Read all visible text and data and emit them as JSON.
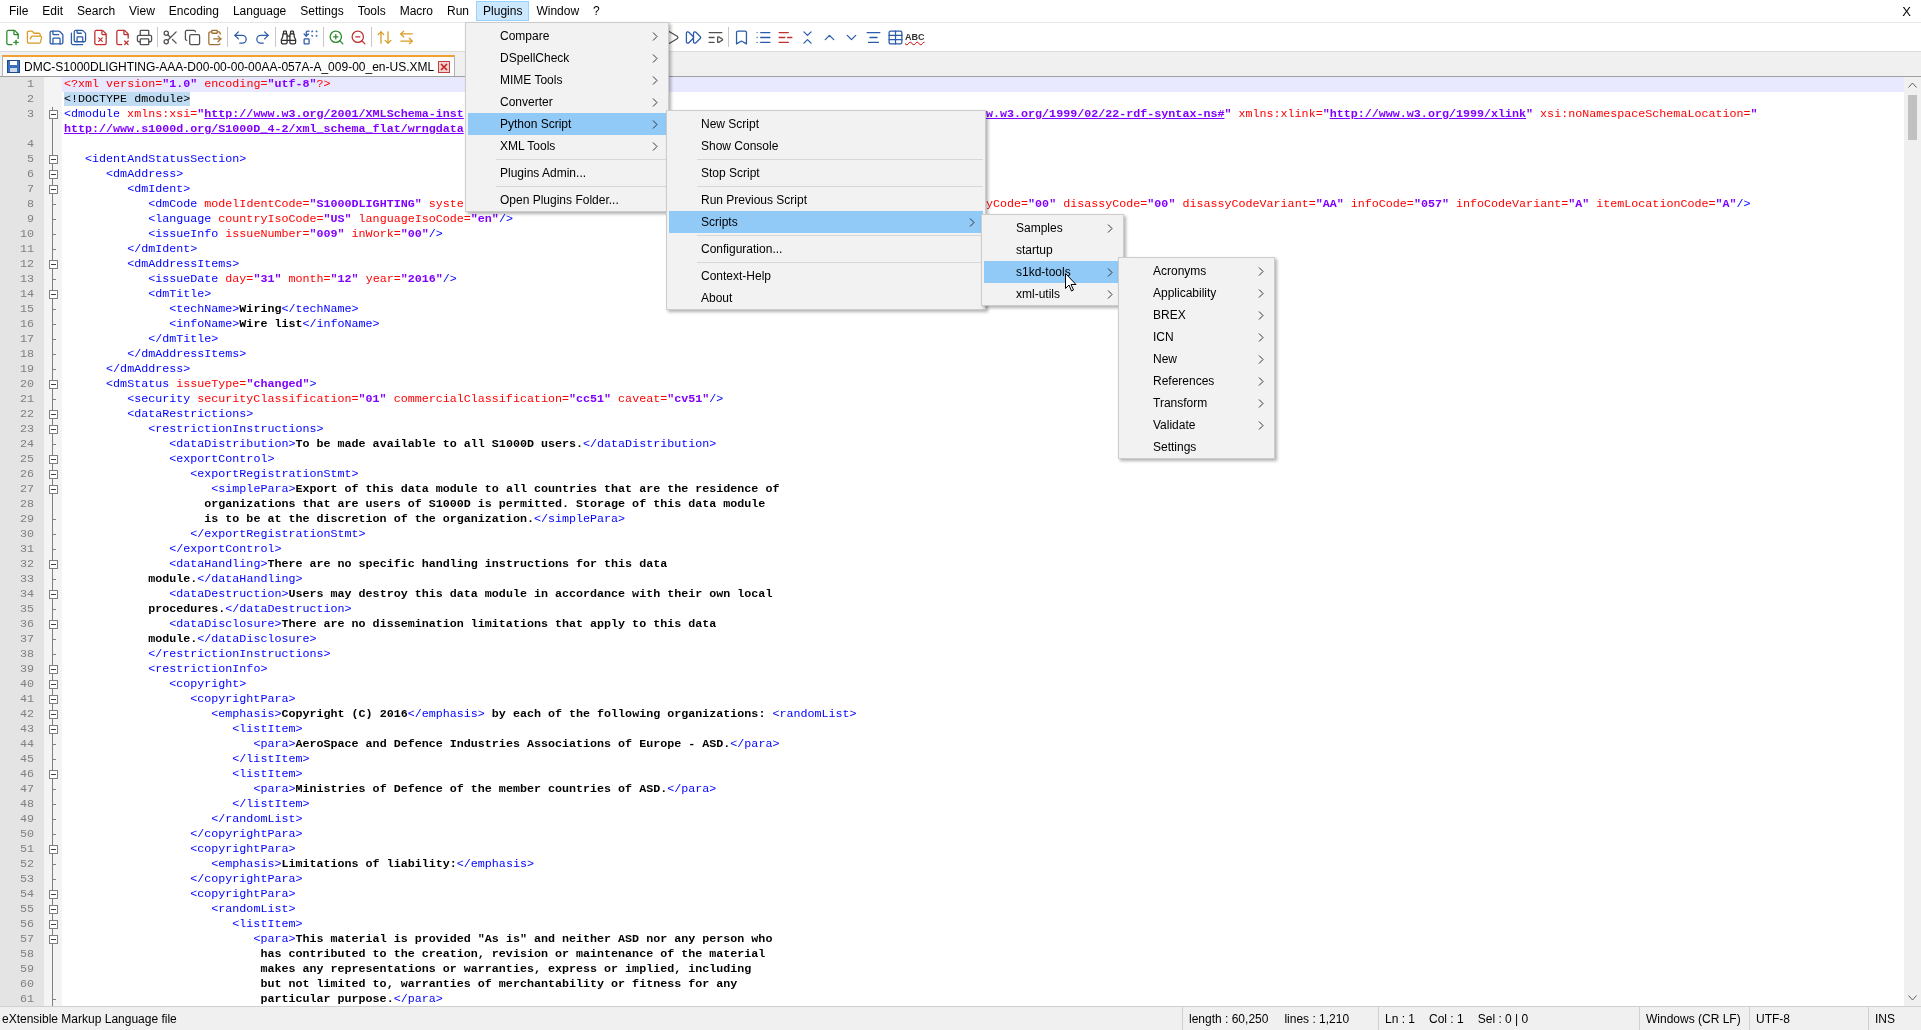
{
  "menu_bar": {
    "items": [
      {
        "label": "File",
        "selected": false
      },
      {
        "label": "Edit",
        "selected": false
      },
      {
        "label": "Search",
        "selected": false
      },
      {
        "label": "View",
        "selected": false
      },
      {
        "label": "Encoding",
        "selected": false
      },
      {
        "label": "Language",
        "selected": false
      },
      {
        "label": "Settings",
        "selected": false
      },
      {
        "label": "Tools",
        "selected": false
      },
      {
        "label": "Macro",
        "selected": false
      },
      {
        "label": "Run",
        "selected": false
      },
      {
        "label": "Plugins",
        "selected": true
      },
      {
        "label": "Window",
        "selected": false
      },
      {
        "label": "?",
        "selected": false
      }
    ],
    "close_label": "X"
  },
  "toolbar": {
    "spellcheck_label": "ABC"
  },
  "tabs": [
    {
      "label": "DMC-S1000DLIGHTING-AAA-D00-00-00-00AA-057A-A_009-00_en-US.XML",
      "selected": true
    }
  ],
  "lines": [
    {
      "n": "1",
      "kind": "none",
      "current": true,
      "tokens": [
        {
          "kind": "pi",
          "text": "<?xml"
        },
        {
          "kind": "attr",
          "text": " version="
        },
        {
          "kind": "val",
          "text": "\"1.0\""
        },
        {
          "kind": "attr",
          "text": " encoding="
        },
        {
          "kind": "val",
          "text": "\"utf-8\""
        },
        {
          "kind": "pi",
          "text": "?>"
        }
      ]
    },
    {
      "n": "2",
      "kind": "none",
      "current": false,
      "tokens": [
        {
          "kind": "match",
          "text": "<!DOCTYPE dmodule>"
        }
      ]
    },
    {
      "n": "3",
      "kind": "box",
      "current": false,
      "tokens": [
        {
          "kind": "tag",
          "text": "<dmodule"
        },
        {
          "kind": "attr",
          "text": " xmlns:xsi="
        },
        {
          "kind": "val",
          "text": "\""
        },
        {
          "kind": "link",
          "text": "http://www.w3.org/2001/XMLSchema-inst"
        }
      ],
      "resume": [
        {
          "kind": "link",
          "text": "w.w3.org/1999/02/22-rdf-syntax-ns#"
        },
        {
          "kind": "val",
          "text": "\""
        },
        {
          "kind": "attr",
          "text": " xmlns:xlink="
        },
        {
          "kind": "val",
          "text": "\""
        },
        {
          "kind": "link",
          "text": "http://www.w3.org/1999/xlink"
        },
        {
          "kind": "val",
          "text": "\""
        },
        {
          "kind": "attr",
          "text": " xsi:noNamespaceSchemaLocation="
        },
        {
          "kind": "val",
          "text": "\""
        }
      ],
      "wrap": [
        {
          "kind": "link",
          "text": "http://www.s1000d.org/S1000D_4-2/xml_schema_flat/wrngdata"
        }
      ]
    },
    {
      "n": "4",
      "kind": "line",
      "current": false
    },
    {
      "n": "5",
      "kind": "box",
      "current": false,
      "tokens": [
        {
          "kind": "tag",
          "text": "   <identAndStatusSection>"
        }
      ]
    },
    {
      "n": "6",
      "kind": "box",
      "current": false,
      "tokens": [
        {
          "kind": "tag",
          "text": "      <dmAddress>"
        }
      ]
    },
    {
      "n": "7",
      "kind": "box",
      "current": false,
      "tokens": [
        {
          "kind": "tag",
          "text": "         <dmIdent>"
        }
      ]
    },
    {
      "n": "8",
      "kind": "tick",
      "current": false,
      "tokens": [
        {
          "kind": "tag",
          "text": "            <dmCode"
        },
        {
          "kind": "attr",
          "text": " modelIdentCode="
        },
        {
          "kind": "val",
          "text": "\"S1000DLIGHTING\""
        },
        {
          "kind": "attr",
          "text": " syste"
        }
      ],
      "resume": [
        {
          "kind": "attr",
          "text": "yCode="
        },
        {
          "kind": "val",
          "text": "\"00\""
        },
        {
          "kind": "attr",
          "text": " disassyCode="
        },
        {
          "kind": "val",
          "text": "\"00\""
        },
        {
          "kind": "attr",
          "text": " disassyCodeVariant="
        },
        {
          "kind": "val",
          "text": "\"AA\""
        },
        {
          "kind": "attr",
          "text": " infoCode="
        },
        {
          "kind": "val",
          "text": "\"057\""
        },
        {
          "kind": "attr",
          "text": " infoCodeVariant="
        },
        {
          "kind": "val",
          "text": "\"A\""
        },
        {
          "kind": "attr",
          "text": " itemLocationCode="
        },
        {
          "kind": "val",
          "text": "\"A\""
        },
        {
          "kind": "tag",
          "text": "/>"
        }
      ]
    },
    {
      "n": "9",
      "kind": "tick",
      "current": false,
      "tokens": [
        {
          "kind": "tag",
          "text": "            <language"
        },
        {
          "kind": "attr",
          "text": " countryIsoCode="
        },
        {
          "kind": "val",
          "text": "\"US\""
        },
        {
          "kind": "attr",
          "text": " languageIsoCode="
        },
        {
          "kind": "val",
          "text": "\"en\""
        },
        {
          "kind": "tag",
          "text": "/>"
        }
      ]
    },
    {
      "n": "10",
      "kind": "tick",
      "current": false,
      "tokens": [
        {
          "kind": "tag",
          "text": "            <issueInfo"
        },
        {
          "kind": "attr",
          "text": " issueNumber="
        },
        {
          "kind": "val",
          "text": "\"009\""
        },
        {
          "kind": "attr",
          "text": " inWork="
        },
        {
          "kind": "val",
          "text": "\"00\""
        },
        {
          "kind": "tag",
          "text": "/>"
        }
      ]
    },
    {
      "n": "11",
      "kind": "tick",
      "current": false,
      "tokens": [
        {
          "kind": "tag",
          "text": "         </dmIdent>"
        }
      ]
    },
    {
      "n": "12",
      "kind": "box",
      "current": false,
      "tokens": [
        {
          "kind": "tag",
          "text": "         <dmAddressItems>"
        }
      ]
    },
    {
      "n": "13",
      "kind": "tick",
      "current": false,
      "tokens": [
        {
          "kind": "tag",
          "text": "            <issueDate"
        },
        {
          "kind": "attr",
          "text": " day="
        },
        {
          "kind": "val",
          "text": "\"31\""
        },
        {
          "kind": "attr",
          "text": " month="
        },
        {
          "kind": "val",
          "text": "\"12\""
        },
        {
          "kind": "attr",
          "text": " year="
        },
        {
          "kind": "val",
          "text": "\"2016\""
        },
        {
          "kind": "tag",
          "text": "/>"
        }
      ]
    },
    {
      "n": "14",
      "kind": "box",
      "current": false,
      "tokens": [
        {
          "kind": "tag",
          "text": "            <dmTitle>"
        }
      ]
    },
    {
      "n": "15",
      "kind": "tick",
      "current": false,
      "tokens": [
        {
          "kind": "tag",
          "text": "               <techName>"
        },
        {
          "kind": "text",
          "text": "Wiring"
        },
        {
          "kind": "tag",
          "text": "</techName>"
        }
      ]
    },
    {
      "n": "16",
      "kind": "tick",
      "current": false,
      "tokens": [
        {
          "kind": "tag",
          "text": "               <infoName>"
        },
        {
          "kind": "text",
          "text": "Wire list"
        },
        {
          "kind": "tag",
          "text": "</infoName>"
        }
      ]
    },
    {
      "n": "17",
      "kind": "tick",
      "current": false,
      "tokens": [
        {
          "kind": "tag",
          "text": "            </dmTitle>"
        }
      ]
    },
    {
      "n": "18",
      "kind": "tick",
      "current": false,
      "tokens": [
        {
          "kind": "tag",
          "text": "         </dmAddressItems>"
        }
      ]
    },
    {
      "n": "19",
      "kind": "tick",
      "current": false,
      "tokens": [
        {
          "kind": "tag",
          "text": "      </dmAddress>"
        }
      ]
    },
    {
      "n": "20",
      "kind": "box",
      "current": false,
      "tokens": [
        {
          "kind": "tag",
          "text": "      <dmStatus"
        },
        {
          "kind": "attr",
          "text": " issueType="
        },
        {
          "kind": "val",
          "text": "\"changed\""
        },
        {
          "kind": "tag",
          "text": ">"
        }
      ]
    },
    {
      "n": "21",
      "kind": "tick",
      "current": false,
      "tokens": [
        {
          "kind": "tag",
          "text": "         <security"
        },
        {
          "kind": "attr",
          "text": " securityClassification="
        },
        {
          "kind": "val",
          "text": "\"01\""
        },
        {
          "kind": "attr",
          "text": " commercialClassification="
        },
        {
          "kind": "val",
          "text": "\"cc51\""
        },
        {
          "kind": "attr",
          "text": " caveat="
        },
        {
          "kind": "val",
          "text": "\"cv51\""
        },
        {
          "kind": "tag",
          "text": "/>"
        }
      ]
    },
    {
      "n": "22",
      "kind": "box",
      "current": false,
      "tokens": [
        {
          "kind": "tag",
          "text": "         <dataRestrictions>"
        }
      ]
    },
    {
      "n": "23",
      "kind": "box",
      "current": false,
      "tokens": [
        {
          "kind": "tag",
          "text": "            <restrictionInstructions>"
        }
      ]
    },
    {
      "n": "24",
      "kind": "tick",
      "current": false,
      "tokens": [
        {
          "kind": "tag",
          "text": "               <dataDistribution>"
        },
        {
          "kind": "text",
          "text": "To be made available to all S1000D users."
        },
        {
          "kind": "tag",
          "text": "</dataDistribution>"
        }
      ]
    },
    {
      "n": "25",
      "kind": "box",
      "current": false,
      "tokens": [
        {
          "kind": "tag",
          "text": "               <exportControl>"
        }
      ]
    },
    {
      "n": "26",
      "kind": "box",
      "current": false,
      "tokens": [
        {
          "kind": "tag",
          "text": "                  <exportRegistrationStmt>"
        }
      ]
    },
    {
      "n": "27",
      "kind": "box",
      "current": false,
      "tokens": [
        {
          "kind": "tag",
          "text": "                     <simplePara>"
        },
        {
          "kind": "text",
          "text": "Export of this data module to all countries that are the residence of"
        }
      ]
    },
    {
      "n": "28",
      "kind": "line",
      "current": false,
      "tokens": [
        {
          "kind": "text",
          "text": "                    organizations that are users of S1000D is permitted. Storage of this data module"
        }
      ]
    },
    {
      "n": "29",
      "kind": "tick",
      "current": false,
      "tokens": [
        {
          "kind": "text",
          "text": "                    is to be at the discretion of the organization."
        },
        {
          "kind": "tag",
          "text": "</simplePara>"
        }
      ]
    },
    {
      "n": "30",
      "kind": "tick",
      "current": false,
      "tokens": [
        {
          "kind": "tag",
          "text": "                  </exportRegistrationStmt>"
        }
      ]
    },
    {
      "n": "31",
      "kind": "tick",
      "current": false,
      "tokens": [
        {
          "kind": "tag",
          "text": "               </exportControl>"
        }
      ]
    },
    {
      "n": "32",
      "kind": "box",
      "current": false,
      "tokens": [
        {
          "kind": "tag",
          "text": "               <dataHandling>"
        },
        {
          "kind": "text",
          "text": "There are no specific handling instructions for this data"
        }
      ]
    },
    {
      "n": "33",
      "kind": "tick",
      "current": false,
      "tokens": [
        {
          "kind": "text",
          "text": "            module."
        },
        {
          "kind": "tag",
          "text": "</dataHandling>"
        }
      ]
    },
    {
      "n": "34",
      "kind": "box",
      "current": false,
      "tokens": [
        {
          "kind": "tag",
          "text": "               <dataDestruction>"
        },
        {
          "kind": "text",
          "text": "Users may destroy this data module in accordance with their own local"
        }
      ]
    },
    {
      "n": "35",
      "kind": "tick",
      "current": false,
      "tokens": [
        {
          "kind": "text",
          "text": "            procedures."
        },
        {
          "kind": "tag",
          "text": "</dataDestruction>"
        }
      ]
    },
    {
      "n": "36",
      "kind": "box",
      "current": false,
      "tokens": [
        {
          "kind": "tag",
          "text": "               <dataDisclosure>"
        },
        {
          "kind": "text",
          "text": "There are no dissemination limitations that apply to this data"
        }
      ]
    },
    {
      "n": "37",
      "kind": "tick",
      "current": false,
      "tokens": [
        {
          "kind": "text",
          "text": "            module."
        },
        {
          "kind": "tag",
          "text": "</dataDisclosure>"
        }
      ]
    },
    {
      "n": "38",
      "kind": "tick",
      "current": false,
      "tokens": [
        {
          "kind": "tag",
          "text": "            </restrictionInstructions>"
        }
      ]
    },
    {
      "n": "39",
      "kind": "box",
      "current": false,
      "tokens": [
        {
          "kind": "tag",
          "text": "            <restrictionInfo>"
        }
      ]
    },
    {
      "n": "40",
      "kind": "box",
      "current": false,
      "tokens": [
        {
          "kind": "tag",
          "text": "               <copyright>"
        }
      ]
    },
    {
      "n": "41",
      "kind": "box",
      "current": false,
      "tokens": [
        {
          "kind": "tag",
          "text": "                  <copyrightPara>"
        }
      ]
    },
    {
      "n": "42",
      "kind": "box",
      "current": false,
      "tokens": [
        {
          "kind": "tag",
          "text": "                     <emphasis>"
        },
        {
          "kind": "text",
          "text": "Copyright (C) 2016"
        },
        {
          "kind": "tag",
          "text": "</emphasis>"
        },
        {
          "kind": "text",
          "text": " by each of the following organizations: "
        },
        {
          "kind": "tag",
          "text": "<randomList>"
        }
      ]
    },
    {
      "n": "43",
      "kind": "box",
      "current": false,
      "tokens": [
        {
          "kind": "tag",
          "text": "                        <listItem>"
        }
      ]
    },
    {
      "n": "44",
      "kind": "tick",
      "current": false,
      "tokens": [
        {
          "kind": "tag",
          "text": "                           <para>"
        },
        {
          "kind": "text",
          "text": "AeroSpace and Defence Industries Associations of Europe - ASD."
        },
        {
          "kind": "tag",
          "text": "</para>"
        }
      ]
    },
    {
      "n": "45",
      "kind": "tick",
      "current": false,
      "tokens": [
        {
          "kind": "tag",
          "text": "                        </listItem>"
        }
      ]
    },
    {
      "n": "46",
      "kind": "box",
      "current": false,
      "tokens": [
        {
          "kind": "tag",
          "text": "                        <listItem>"
        }
      ]
    },
    {
      "n": "47",
      "kind": "tick",
      "current": false,
      "tokens": [
        {
          "kind": "tag",
          "text": "                           <para>"
        },
        {
          "kind": "text",
          "text": "Ministries of Defence of the member countries of ASD."
        },
        {
          "kind": "tag",
          "text": "</para>"
        }
      ]
    },
    {
      "n": "48",
      "kind": "tick",
      "current": false,
      "tokens": [
        {
          "kind": "tag",
          "text": "                        </listItem>"
        }
      ]
    },
    {
      "n": "49",
      "kind": "tick",
      "current": false,
      "tokens": [
        {
          "kind": "tag",
          "text": "                     </randomList>"
        }
      ]
    },
    {
      "n": "50",
      "kind": "tick",
      "current": false,
      "tokens": [
        {
          "kind": "tag",
          "text": "                  </copyrightPara>"
        }
      ]
    },
    {
      "n": "51",
      "kind": "box",
      "current": false,
      "tokens": [
        {
          "kind": "tag",
          "text": "                  <copyrightPara>"
        }
      ]
    },
    {
      "n": "52",
      "kind": "tick",
      "current": false,
      "tokens": [
        {
          "kind": "tag",
          "text": "                     <emphasis>"
        },
        {
          "kind": "text",
          "text": "Limitations of liability:"
        },
        {
          "kind": "tag",
          "text": "</emphasis>"
        }
      ]
    },
    {
      "n": "53",
      "kind": "tick",
      "current": false,
      "tokens": [
        {
          "kind": "tag",
          "text": "                  </copyrightPara>"
        }
      ]
    },
    {
      "n": "54",
      "kind": "box",
      "current": false,
      "tokens": [
        {
          "kind": "tag",
          "text": "                  <copyrightPara>"
        }
      ]
    },
    {
      "n": "55",
      "kind": "box",
      "current": false,
      "tokens": [
        {
          "kind": "tag",
          "text": "                     <randomList>"
        }
      ]
    },
    {
      "n": "56",
      "kind": "box",
      "current": false,
      "tokens": [
        {
          "kind": "tag",
          "text": "                        <listItem>"
        }
      ]
    },
    {
      "n": "57",
      "kind": "box",
      "current": false,
      "tokens": [
        {
          "kind": "tag",
          "text": "                           <para>"
        },
        {
          "kind": "text",
          "text": "This material is provided \"As is\" and neither ASD nor any person who"
        }
      ]
    },
    {
      "n": "58",
      "kind": "line",
      "current": false,
      "tokens": [
        {
          "kind": "text",
          "text": "                            has contributed to the creation, revision or maintenance of the material"
        }
      ]
    },
    {
      "n": "59",
      "kind": "line",
      "current": false,
      "tokens": [
        {
          "kind": "text",
          "text": "                            makes any representations or warranties, express or implied, including"
        }
      ]
    },
    {
      "n": "60",
      "kind": "line",
      "current": false,
      "tokens": [
        {
          "kind": "text",
          "text": "                            but not limited to, warranties of merchantability or fitness for any"
        }
      ]
    },
    {
      "n": "61",
      "kind": "tick",
      "current": false,
      "tokens": [
        {
          "kind": "text",
          "text": "                            particular purpose."
        },
        {
          "kind": "tag",
          "text": "</para>"
        }
      ]
    }
  ],
  "plugins_menu": {
    "items": [
      {
        "kind": "item",
        "label": "Compare",
        "submenu": true,
        "selected": false
      },
      {
        "kind": "item",
        "label": "DSpellCheck",
        "submenu": true,
        "selected": false
      },
      {
        "kind": "item",
        "label": "MIME Tools",
        "submenu": true,
        "selected": false
      },
      {
        "kind": "item",
        "label": "Converter",
        "submenu": true,
        "selected": false
      },
      {
        "kind": "item",
        "label": "Python Script",
        "submenu": true,
        "selected": true,
        "children": [
          {
            "kind": "item",
            "label": "New Script",
            "submenu": false,
            "selected": false
          },
          {
            "kind": "item",
            "label": "Show Console",
            "submenu": false,
            "selected": false
          },
          {
            "kind": "separator"
          },
          {
            "kind": "item",
            "label": "Stop Script",
            "submenu": false,
            "selected": false
          },
          {
            "kind": "separator"
          },
          {
            "kind": "item",
            "label": "Run Previous Script",
            "submenu": false,
            "selected": false
          },
          {
            "kind": "item",
            "label": "Scripts",
            "submenu": true,
            "selected": true,
            "children": [
              {
                "kind": "item",
                "label": "Samples",
                "submenu": true,
                "selected": false
              },
              {
                "kind": "item",
                "label": "startup",
                "submenu": false,
                "selected": false
              },
              {
                "kind": "item",
                "label": "s1kd-tools",
                "submenu": true,
                "selected": true,
                "children": [
                  {
                    "kind": "item",
                    "label": "Acronyms",
                    "submenu": true,
                    "selected": false
                  },
                  {
                    "kind": "item",
                    "label": "Applicability",
                    "submenu": true,
                    "selected": false
                  },
                  {
                    "kind": "item",
                    "label": "BREX",
                    "submenu": true,
                    "selected": false
                  },
                  {
                    "kind": "item",
                    "label": "ICN",
                    "submenu": true,
                    "selected": false
                  },
                  {
                    "kind": "item",
                    "label": "New",
                    "submenu": true,
                    "selected": false
                  },
                  {
                    "kind": "item",
                    "label": "References",
                    "submenu": true,
                    "selected": false
                  },
                  {
                    "kind": "item",
                    "label": "Transform",
                    "submenu": true,
                    "selected": false
                  },
                  {
                    "kind": "item",
                    "label": "Validate",
                    "submenu": true,
                    "selected": false
                  },
                  {
                    "kind": "item",
                    "label": "Settings",
                    "submenu": false,
                    "selected": false
                  }
                ]
              },
              {
                "kind": "item",
                "label": "xml-utils",
                "submenu": true,
                "selected": false
              }
            ]
          },
          {
            "kind": "separator"
          },
          {
            "kind": "item",
            "label": "Configuration...",
            "submenu": false,
            "selected": false
          },
          {
            "kind": "separator"
          },
          {
            "kind": "item",
            "label": "Context-Help",
            "submenu": false,
            "selected": false
          },
          {
            "kind": "item",
            "label": "About",
            "submenu": false,
            "selected": false
          }
        ]
      },
      {
        "kind": "item",
        "label": "XML Tools",
        "submenu": true,
        "selected": false
      },
      {
        "kind": "separator"
      },
      {
        "kind": "item",
        "label": "Plugins Admin...",
        "submenu": false,
        "selected": false
      },
      {
        "kind": "separator"
      },
      {
        "kind": "item",
        "label": "Open Plugins Folder...",
        "submenu": false,
        "selected": false
      }
    ]
  },
  "status_bar": {
    "file_type": "eXtensible Markup Language file",
    "length": "length : 60,250",
    "lines": "lines : 1,210",
    "ln": "Ln : 1",
    "col": "Col : 1",
    "sel": "Sel : 0 | 0",
    "eol": "Windows (CR LF)",
    "encoding": "UTF-8",
    "mode": "INS"
  }
}
